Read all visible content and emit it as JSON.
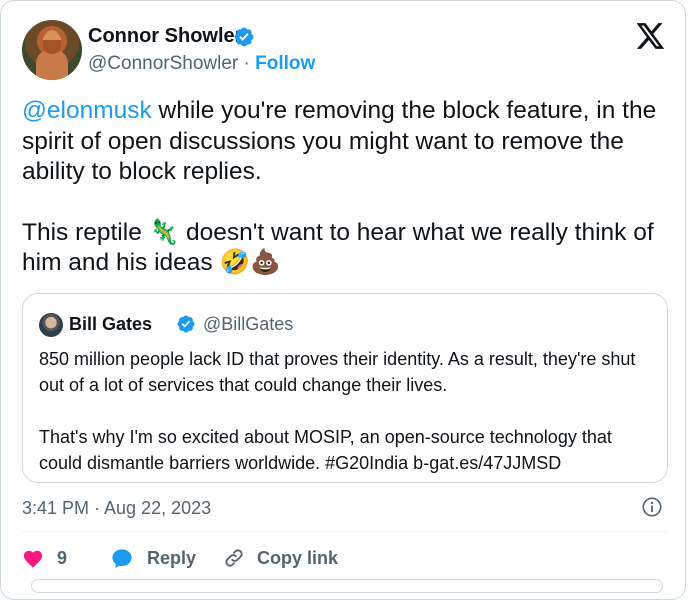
{
  "author": {
    "name": "Connor Showler",
    "handle": "@ConnorShowler",
    "separator": " · ",
    "follow_label": "Follow"
  },
  "tweet": {
    "mention": "@elonmusk",
    "line1_rest": " while you're removing the block feature, in the spirit of open discussions you might want to remove the ability to block replies.",
    "line2_start": "This reptile ",
    "emoji_lizard": "🦎",
    "line2_rest": " doesn't want to hear what we really think of him and his ideas ",
    "emoji_end": "🤣💩"
  },
  "quote": {
    "name": "Bill Gates",
    "handle": "@BillGates",
    "para1": "850 million people lack ID that proves their identity. As a result, they're shut out of a lot of services that could change their lives.",
    "para2": "That's why I'm so excited about MOSIP, an open-source technology that could dismantle barriers worldwide. #G20India b-gat.es/47JJMSD"
  },
  "timestamp": "3:41 PM · Aug 22, 2023",
  "actions": {
    "like_count": "9",
    "reply_label": "Reply",
    "copy_label": "Copy link"
  },
  "colors": {
    "accent": "#1d9bf0",
    "like": "#f91880",
    "secondary_text": "#536471"
  },
  "icons": [
    "verified-badge-icon",
    "x-logo-icon",
    "info-icon",
    "heart-icon",
    "reply-bubble-icon",
    "link-icon"
  ]
}
